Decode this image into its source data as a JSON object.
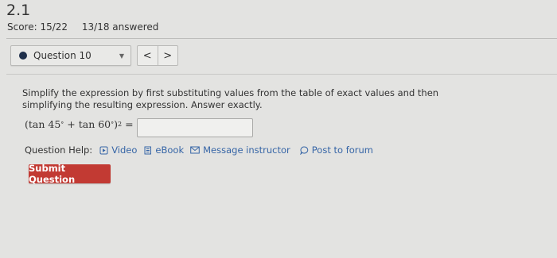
{
  "header": {
    "section": "2.1",
    "score_label": "Score: 15/22",
    "answered": "13/18 answered"
  },
  "question_nav": {
    "selected": "Question 10",
    "prev_glyph": "<",
    "next_glyph": ">"
  },
  "question": {
    "prompt": "Simplify the expression by first substituting values from the table of exact values and then simplifying the resulting expression. Answer exactly.",
    "expression": {
      "open": "(tan 45",
      "deg1": "°",
      "plus": " + tan 60",
      "deg2": "°",
      "close": ")",
      "power": "2",
      "equals": " ="
    },
    "answer_value": ""
  },
  "help": {
    "label": "Question Help:",
    "links": [
      "Video",
      "eBook",
      "Message instructor",
      "Post to forum"
    ]
  },
  "submit_label": "Submit Question",
  "colors": {
    "background": "#e3e3e1",
    "link": "#3665a6",
    "submit": "#c23a33",
    "indicator_dot": "#1e2f4a"
  }
}
